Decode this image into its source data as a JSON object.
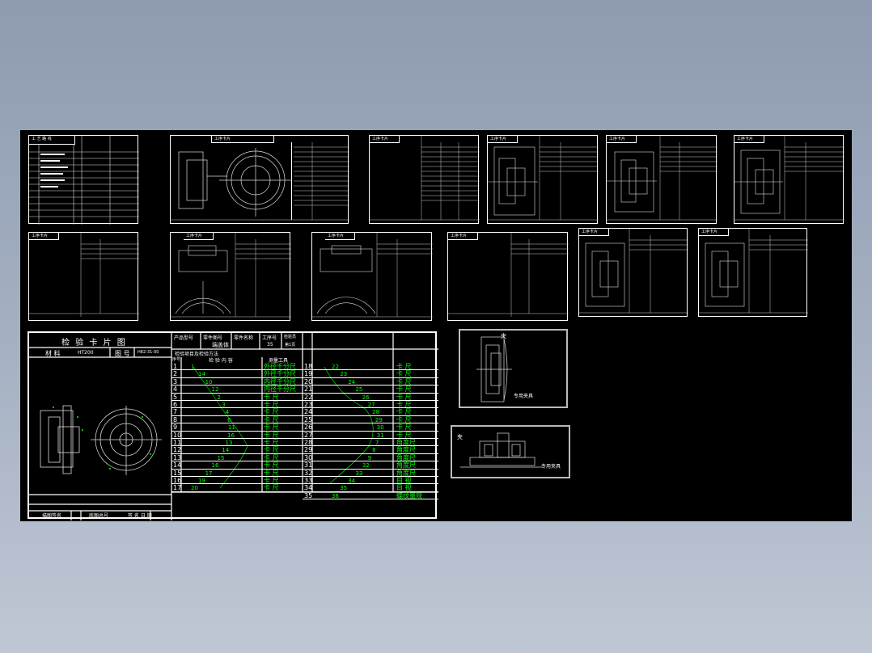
{
  "sheets": {
    "top_row_titles": [
      "工 艺 路 线",
      "工序卡片",
      "工序卡片",
      "工序卡片",
      "工序卡片",
      "工序卡片"
    ],
    "mid_row_titles": [
      "工序卡片",
      "工序卡片",
      "工序卡片",
      "工序卡片",
      "工序卡片",
      "工序卡片"
    ]
  },
  "inspection_card": {
    "title": "检 验 卡 片 图",
    "material_label": "材 料",
    "material_value": "HT200",
    "part_label": "图 号",
    "part_value": "H82-31-00",
    "footer_left": "描图签名",
    "footer_mid": "底图总号",
    "footer_right": "签 名 日 期",
    "header_cells": [
      "产品型号",
      "零件图号",
      "零件名称",
      "工序号",
      "检验员"
    ],
    "part_name": "端盖体",
    "op_no": "35",
    "page_info": "第1页",
    "section_title": "检验项目及检验方法",
    "col_headers": [
      "序号",
      "检  验  内  容",
      "测量工具"
    ],
    "left_rows": [
      {
        "n": "1",
        "dim": "1",
        "tool": "外径千分尺"
      },
      {
        "n": "2",
        "dim": "14",
        "tool": "外径千分尺"
      },
      {
        "n": "3",
        "dim": "10",
        "tool": "内径千分尺"
      },
      {
        "n": "4",
        "dim": "12",
        "tool": "内径千分尺"
      },
      {
        "n": "5",
        "dim": "2",
        "tool": "卡  尺"
      },
      {
        "n": "6",
        "dim": "3",
        "tool": "卡  尺"
      },
      {
        "n": "7",
        "dim": "4",
        "tool": "卡  尺"
      },
      {
        "n": "8",
        "dim": "6",
        "tool": "卡  尺"
      },
      {
        "n": "9",
        "dim": "11",
        "tool": "卡  尺"
      },
      {
        "n": "10",
        "dim": "16",
        "tool": "卡  尺"
      },
      {
        "n": "11",
        "dim": "13",
        "tool": "卡  尺"
      },
      {
        "n": "12",
        "dim": "14",
        "tool": "卡  尺"
      },
      {
        "n": "13",
        "dim": "15",
        "tool": "卡  尺"
      },
      {
        "n": "14",
        "dim": "16",
        "tool": "卡  尺"
      },
      {
        "n": "15",
        "dim": "17",
        "tool": "卡  尺"
      },
      {
        "n": "16",
        "dim": "19",
        "tool": "卡  尺"
      },
      {
        "n": "17",
        "dim": "20",
        "tool": "卡  尺"
      }
    ],
    "right_rows": [
      {
        "n": "18",
        "dim": "22",
        "tool": "卡  尺"
      },
      {
        "n": "19",
        "dim": "23",
        "tool": "卡  尺"
      },
      {
        "n": "20",
        "dim": "24",
        "tool": "卡  尺"
      },
      {
        "n": "21",
        "dim": "25",
        "tool": "卡  尺"
      },
      {
        "n": "22",
        "dim": "26",
        "tool": "卡  尺"
      },
      {
        "n": "23",
        "dim": "27",
        "tool": "卡  尺"
      },
      {
        "n": "24",
        "dim": "28",
        "tool": "卡  尺"
      },
      {
        "n": "25",
        "dim": "29",
        "tool": "卡  尺"
      },
      {
        "n": "26",
        "dim": "30",
        "tool": "卡  尺"
      },
      {
        "n": "27",
        "dim": "31",
        "tool": "卡  尺"
      },
      {
        "n": "28",
        "dim": "7",
        "tool": "角度尺"
      },
      {
        "n": "29",
        "dim": "8",
        "tool": "角度尺"
      },
      {
        "n": "30",
        "dim": "9",
        "tool": "角度尺"
      },
      {
        "n": "31",
        "dim": "32",
        "tool": "角度尺"
      },
      {
        "n": "32",
        "dim": "33",
        "tool": "角度尺"
      },
      {
        "n": "33",
        "dim": "34",
        "tool": "目  视"
      },
      {
        "n": "34",
        "dim": "35",
        "tool": "目  视"
      },
      {
        "n": "35",
        "dim": "36",
        "tool": "螺纹量规"
      }
    ]
  },
  "fixtures": {
    "fixture1_label": "夹",
    "fixture1_caption": "专用夹具",
    "fixture2_label": "夹",
    "fixture2_caption": "专用夹具"
  }
}
